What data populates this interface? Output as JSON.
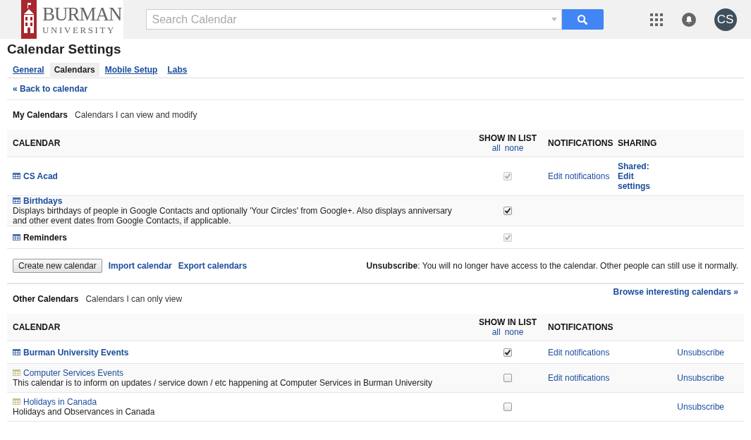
{
  "header": {
    "logo": {
      "name": "BURMAN",
      "subtitle": "UNIVERSITY"
    },
    "search": {
      "placeholder": "Search Calendar"
    },
    "avatar": "CS"
  },
  "page_title": "Calendar Settings",
  "tabs": [
    {
      "label": "General",
      "selected": false
    },
    {
      "label": "Calendars",
      "selected": true
    },
    {
      "label": "Mobile Setup",
      "selected": false
    },
    {
      "label": "Labs",
      "selected": false
    }
  ],
  "back_link": "« Back to calendar",
  "sections": [
    {
      "title": "My Calendars",
      "subtitle": "Calendars I can view and modify",
      "columns": {
        "calendar": "CALENDAR",
        "show_in_list": "SHOW IN LIST",
        "show_all": "all",
        "show_none": "none",
        "notifications": "NOTIFICATIONS",
        "sharing": "SHARING"
      },
      "rows": [
        {
          "name": "CS Acad",
          "bold": true,
          "linked": true,
          "color": "#4a6fb0",
          "checked": true,
          "disabled": true,
          "notifications": "Edit notifications",
          "sharing": "Shared: Edit settings"
        },
        {
          "name": "Birthdays",
          "bold": true,
          "linked": true,
          "color": "#4a6fb0",
          "description": "Displays birthdays of people in Google Contacts and optionally 'Your Circles' from Google+. Also displays anniversary and other event dates from Google Contacts, if applicable.",
          "checked": true,
          "disabled": false
        },
        {
          "name": "Reminders",
          "bold": true,
          "linked": false,
          "color": "#4a6fb0",
          "checked": true,
          "disabled": true
        }
      ],
      "actions": {
        "button": "Create new calendar",
        "links": [
          "Import calendar",
          "Export calendars"
        ],
        "note": "**Unsubscribe**: You will no longer have access to the calendar. Other people can still use it normally."
      }
    },
    {
      "title": "Other Calendars",
      "subtitle": "Calendars I can only view",
      "browse_link": "Browse interesting calendars »",
      "columns": {
        "calendar": "CALENDAR",
        "show_in_list": "SHOW IN LIST",
        "show_all": "all",
        "show_none": "none",
        "notifications": "NOTIFICATIONS"
      },
      "rows": [
        {
          "name": "Burman University Events",
          "bold": true,
          "linked": true,
          "color": "#4a6fb0",
          "checked": true,
          "disabled": false,
          "notifications": "Edit notifications",
          "unsubscribe": "Unsubscribe"
        },
        {
          "name": "Computer Services Events",
          "bold": false,
          "linked": true,
          "color": "#c9c391",
          "description": "This calendar is to inform on updates / service down / etc happening at Computer Services in Burman University",
          "checked": false,
          "disabled": false,
          "notifications": "Edit notifications",
          "unsubscribe": "Unsubscribe"
        },
        {
          "name": "Holidays in Canada",
          "bold": false,
          "linked": true,
          "color": "#c9c391",
          "description": "Holidays and Observances in Canada",
          "checked": false,
          "disabled": false,
          "unsubscribe": "Unsubscribe"
        }
      ]
    }
  ]
}
